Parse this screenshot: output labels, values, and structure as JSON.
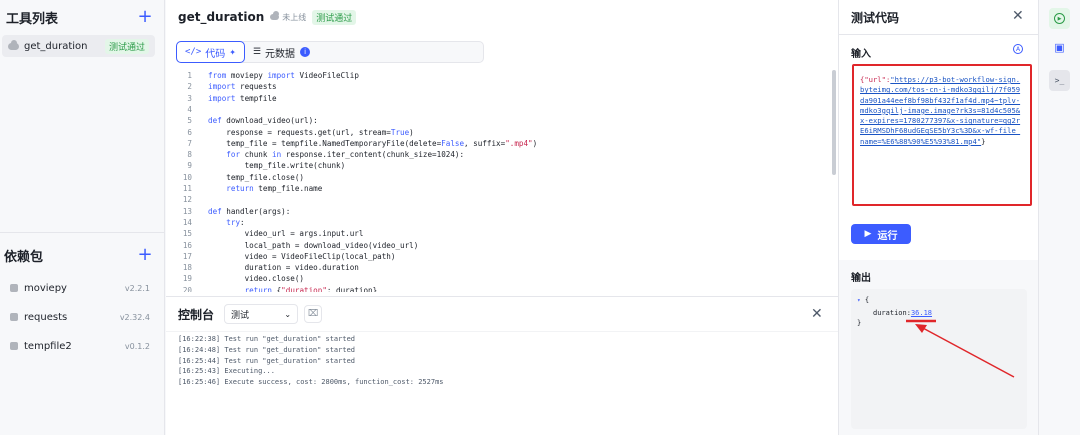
{
  "sidebar": {
    "tools_title": "工具列表",
    "tools": [
      {
        "name": "get_duration",
        "badge": "测试通过"
      }
    ],
    "deps_title": "依赖包",
    "deps": [
      {
        "name": "moviepy",
        "version": "v2.2.1"
      },
      {
        "name": "requests",
        "version": "v2.32.4"
      },
      {
        "name": "tempfile2",
        "version": "v0.1.2"
      }
    ]
  },
  "header": {
    "function_name": "get_duration",
    "status_offline": "未上线",
    "status_badge": "测试通过"
  },
  "tabs": {
    "code": "代码",
    "metadata": "元数据"
  },
  "code_lines": [
    "from moviepy import VideoFileClip",
    "import requests",
    "import tempfile",
    "",
    "def download_video(url):",
    "    response = requests.get(url, stream=True)",
    "    temp_file = tempfile.NamedTemporaryFile(delete=False, suffix=\".mp4\")",
    "    for chunk in response.iter_content(chunk_size=1024):",
    "        temp_file.write(chunk)",
    "    temp_file.close()",
    "    return temp_file.name",
    "",
    "def handler(args):",
    "    try:",
    "        video_url = args.input.url",
    "        local_path = download_video(video_url)",
    "        video = VideoFileClip(local_path)",
    "        duration = video.duration",
    "        video.close()",
    "        return {\"duration\": duration}"
  ],
  "console": {
    "title": "控制台",
    "select_value": "测试",
    "logs": [
      "[16:22:38] Test run \"get_duration\" started",
      "[16:24:48] Test run \"get_duration\" started",
      "[16:25:44] Test run \"get_duration\" started",
      "[16:25:43] Executing...",
      "[16:25:46] Execute success, cost: 2800ms, function_cost: 2527ms"
    ]
  },
  "test_panel": {
    "title": "测试代码",
    "input_label": "输入",
    "input_json_key": "{\"url\":",
    "input_json_url": "\"https://p3-bot-workflow-sign.byteimg.com/tos-cn-i-mdko3gqilj/7f059da901a44eef8bf98bf432f1af4d.mp4~tplv-mdko3gqilj-image.image?rk3s=81d4c505&x-expires=1780277397&x-signature=qg2rE6iRMSDhF68udGEqSE5bY3c%3D&x-wf-file_name=%E6%88%90%E5%93%81.mp4\"",
    "input_json_close": "}",
    "run_label": "运行",
    "output_label": "输出",
    "output_open": "{",
    "output_key": "duration:",
    "output_value": "36.18",
    "output_close": "}"
  },
  "colors": {
    "accent": "#3c5cff",
    "highlight": "#e0262a",
    "success": "#2a9b47"
  },
  "icons": {
    "run_panel": "play-circle-icon",
    "monitor": "monitor-icon",
    "terminal": "terminal-icon"
  }
}
